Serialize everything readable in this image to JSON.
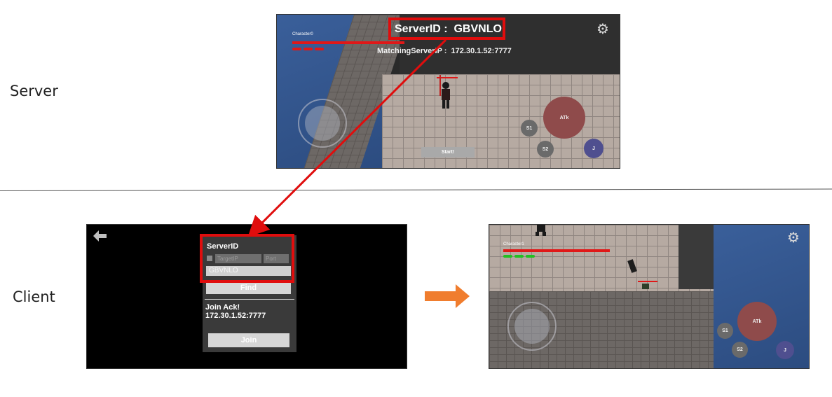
{
  "labels": {
    "server": "Server",
    "client": "Client"
  },
  "server_view": {
    "server_id_label": "ServerID :  GBVNLO",
    "matching_server_ip": "MatchingServerIP :  172.30.1.52:7777",
    "character_name": "Character0",
    "start_button": "Start!",
    "attack_button": "ATk",
    "skill1_button": "S1",
    "skill2_button": "S2",
    "jump_button": "J"
  },
  "client_login": {
    "title": "ServerID",
    "target_ip_placeholder": "TargetIP",
    "port_placeholder": "Port",
    "server_id_value": "GBVNLO",
    "find_button": "Find",
    "join_ack_title": "Join Ack!",
    "join_ack_address": "172.30.1.52:7777",
    "join_button": "Join"
  },
  "client_game": {
    "character_name": "Character1",
    "attack_button": "ATk",
    "skill1_button": "S1",
    "skill2_button": "S2",
    "jump_button": "J"
  },
  "colors": {
    "highlight": "#e00d0d",
    "transition_arrow": "#f07d2e",
    "hp_bar": "#e01818",
    "stamina_green": "#22c022",
    "attack_button": "#8f4b4b",
    "jump_button": "#4f4f8f"
  }
}
